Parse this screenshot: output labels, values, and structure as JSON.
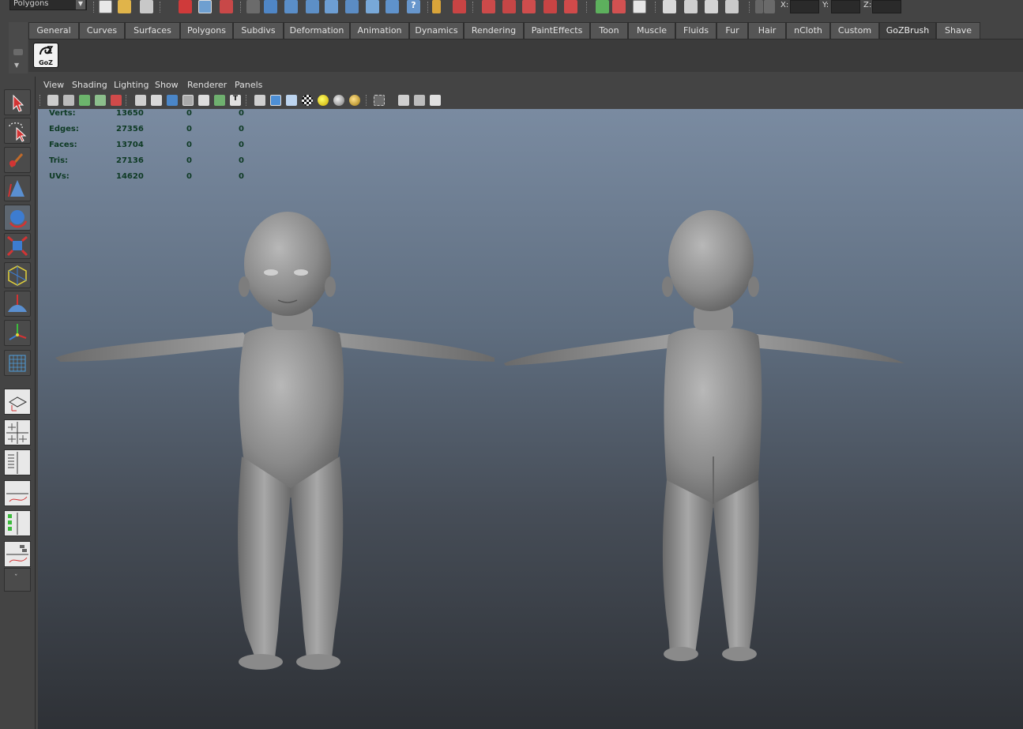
{
  "statusline": {
    "mode_selector": "Polygons",
    "coords": {
      "x_label": "X:",
      "y_label": "Y:",
      "z_label": "Z:"
    }
  },
  "shelf": {
    "tabs": [
      "General",
      "Curves",
      "Surfaces",
      "Polygons",
      "Subdivs",
      "Deformation",
      "Animation",
      "Dynamics",
      "Rendering",
      "PaintEffects",
      "Toon",
      "Muscle",
      "Fluids",
      "Fur",
      "Hair",
      "nCloth",
      "Custom",
      "GoZBrush",
      "Shave"
    ],
    "active_tab": "GoZBrush",
    "goz_button_label": "GoZ"
  },
  "panel": {
    "menu": [
      "View",
      "Shading",
      "Lighting",
      "Show",
      "Renderer",
      "Panels"
    ]
  },
  "hud": {
    "rows": [
      {
        "label": "Verts:",
        "values": [
          "13650",
          "0",
          "0"
        ]
      },
      {
        "label": "Edges:",
        "values": [
          "27356",
          "0",
          "0"
        ]
      },
      {
        "label": "Faces:",
        "values": [
          "13704",
          "0",
          "0"
        ]
      },
      {
        "label": "Tris:",
        "values": [
          "27136",
          "0",
          "0"
        ]
      },
      {
        "label": "UVs:",
        "values": [
          "14620",
          "0",
          "0"
        ]
      }
    ]
  },
  "colors": {
    "ui_background": "#444444",
    "viewport_top": "#7a8ba1",
    "viewport_bottom": "#2e3136",
    "hud_text": "#0e3a24",
    "model_gray": "#8a8a8a"
  }
}
